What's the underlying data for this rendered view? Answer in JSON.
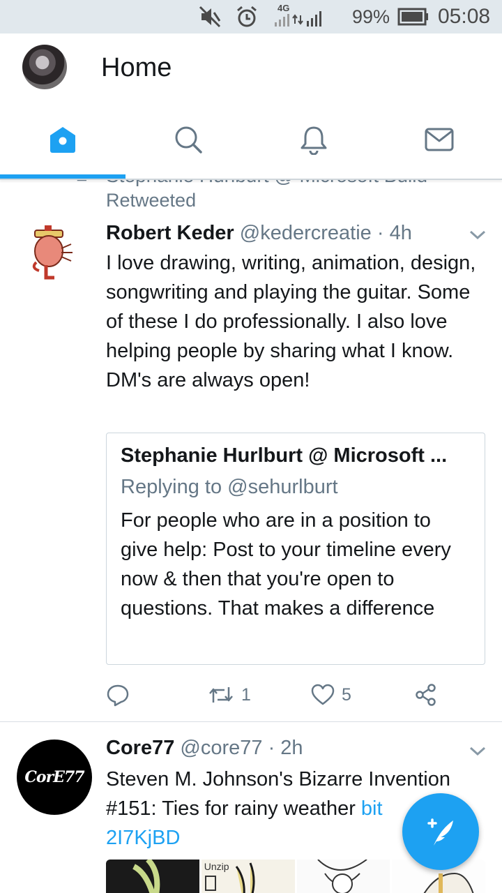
{
  "status_bar": {
    "network": "4G",
    "battery": "99%",
    "time": "05:08"
  },
  "header": {
    "title": "Home"
  },
  "tabs": [
    {
      "name": "home",
      "icon": "home-icon",
      "active": true
    },
    {
      "name": "search",
      "icon": "search-icon",
      "active": false
    },
    {
      "name": "notifications",
      "icon": "bell-icon",
      "active": false
    },
    {
      "name": "messages",
      "icon": "mail-icon",
      "active": false
    }
  ],
  "colors": {
    "accent": "#1da1f2",
    "secondary_text": "#657786",
    "primary_text": "#14171a"
  },
  "feed": {
    "retweet_header": {
      "retweeter": "Stephanie Hurlburt @ Microsoft Build",
      "label": "Retweeted"
    },
    "tweet1": {
      "name": "Robert Keder",
      "handle": "@kedercreatie",
      "time": "· 4h",
      "text": "I love drawing, writing, animation, design, songwriting and playing the guitar. Some of these I do professionally. I also love helping people by sharing what I know. DM's are always open!",
      "quote": {
        "name": "Stephanie Hurlburt @ Microsoft ...",
        "replying_to": "Replying to @sehurlburt",
        "text": "For people who are in a position to give help: Post to your timeline every now & then that you're open to questions. That makes a difference"
      },
      "actions": {
        "retweets": "1",
        "likes": "5"
      }
    },
    "tweet2": {
      "name": "Core77",
      "handle": "@core77",
      "time": "· 2h",
      "avatar_text": "CorE77",
      "text_prefix": "Steven M. Johnson's Bizarre Invention #151: Ties for rainy weather ",
      "link": "bit.ly/2I7KjBD",
      "link_visible_line1": "bit",
      "link_visible_line2": "2I7KjBD",
      "image_caption": "Unzip"
    }
  }
}
